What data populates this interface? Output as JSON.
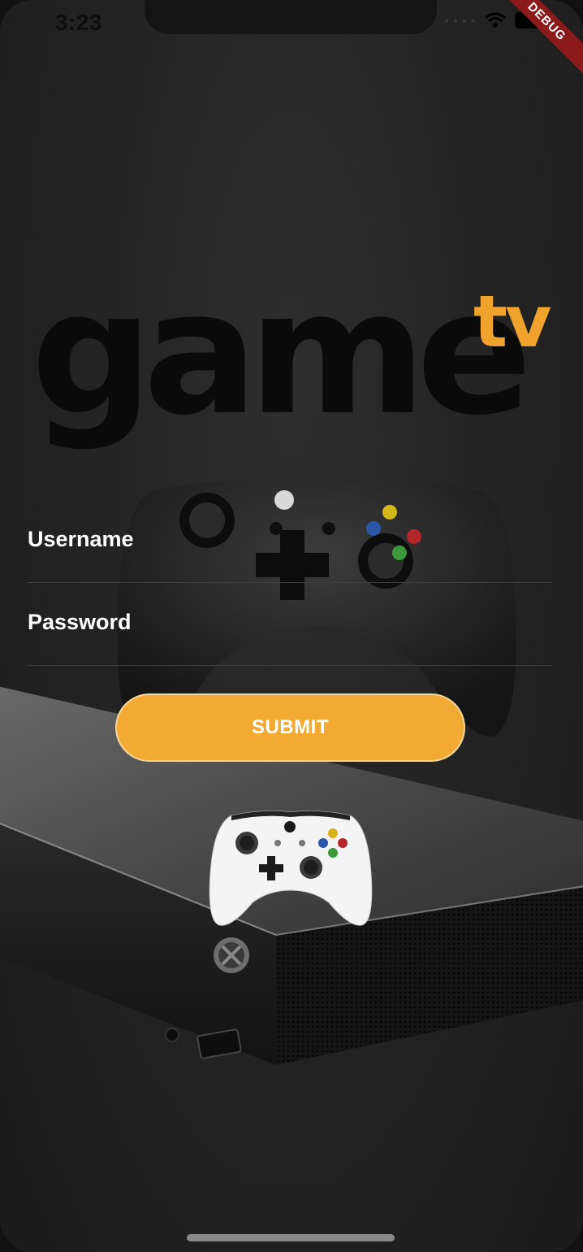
{
  "status_bar": {
    "time": "3:23",
    "debug_label": "DEBUG"
  },
  "logo": {
    "word": "game",
    "suffix": "tv",
    "suffix_color": "#f0a32c"
  },
  "form": {
    "username_label": "Username",
    "password_label": "Password",
    "submit_label": "SUBMIT",
    "accent_color": "#f2aa33"
  },
  "icons": [
    "wifi-icon",
    "battery-icon",
    "xbox-controller-icon",
    "xbox-console-icon"
  ]
}
